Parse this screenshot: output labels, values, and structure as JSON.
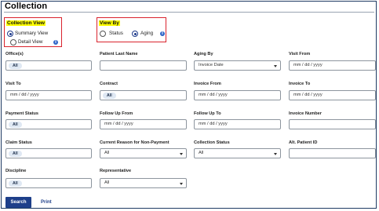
{
  "page": {
    "title": "Collection"
  },
  "collection_view": {
    "heading": "Collection View",
    "options": [
      {
        "label": "Summary View",
        "selected": true
      },
      {
        "label": "Detail View",
        "selected": false
      }
    ]
  },
  "view_by": {
    "heading": "View By",
    "options": [
      {
        "label": "Status",
        "selected": false
      },
      {
        "label": "Aging",
        "selected": true
      }
    ]
  },
  "fields": {
    "offices": {
      "label": "Office(s)",
      "tag": "All"
    },
    "patient_last_name": {
      "label": "Patient Last Name",
      "value": ""
    },
    "aging_by": {
      "label": "Aging By",
      "value": "Invoice Date"
    },
    "visit_from": {
      "label": "Visit From",
      "placeholder": "mm / dd / yyyy"
    },
    "visit_to": {
      "label": "Visit To",
      "placeholder": "mm / dd / yyyy"
    },
    "contract": {
      "label": "Contract",
      "tag": "All"
    },
    "invoice_from": {
      "label": "Invoice From",
      "placeholder": "mm / dd / yyyy"
    },
    "invoice_to": {
      "label": "Invoice To",
      "placeholder": "mm / dd / yyyy"
    },
    "payment_status": {
      "label": "Payment Status",
      "tag": "All"
    },
    "follow_up_from": {
      "label": "Follow Up From",
      "placeholder": "mm / dd / yyyy"
    },
    "follow_up_to": {
      "label": "Follow Up To",
      "placeholder": "mm / dd / yyyy"
    },
    "invoice_number": {
      "label": "Invoice Number",
      "value": ""
    },
    "claim_status": {
      "label": "Claim Status",
      "tag": "All"
    },
    "current_reason": {
      "label": "Current Reason for Non-Payment",
      "value": "All"
    },
    "collection_status": {
      "label": "Collection Status",
      "value": "All"
    },
    "alt_patient_id": {
      "label": "Alt. Patient ID",
      "value": ""
    },
    "discipline": {
      "label": "Discipline",
      "tag": "All"
    },
    "representative": {
      "label": "Representative",
      "value": "All"
    }
  },
  "actions": {
    "search": "Search",
    "print": "Print"
  },
  "colors": {
    "primary": "#1e3f8a",
    "highlight": "#ffff00",
    "annotation": "#d9232d",
    "info": "#2e64c7"
  },
  "icons": [
    "info-icon",
    "chevron-down-icon",
    "radio-icon"
  ]
}
